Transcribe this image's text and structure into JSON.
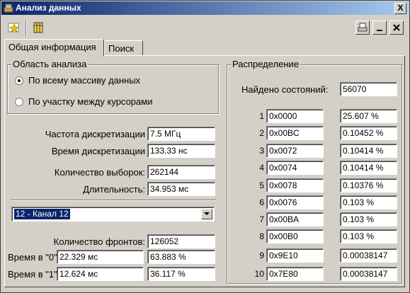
{
  "window": {
    "title": "Анализ данных",
    "close_label": "X"
  },
  "toolbar": {
    "icons": [
      "star-icon",
      "grid-icon"
    ],
    "window_icons": [
      "printer-icon",
      "minimize-icon",
      "close-icon"
    ]
  },
  "tabs": [
    {
      "label": "Общая информация",
      "active": true
    },
    {
      "label": "Поиск",
      "active": false
    }
  ],
  "analysis_area": {
    "label": "Область анализа",
    "options": [
      {
        "label": "По всему массиву данных",
        "selected": true
      },
      {
        "label": "По участку между курсорами",
        "selected": false
      }
    ]
  },
  "info": {
    "sampling_rate_label": "Частота дискретизации",
    "sampling_rate": "7.5 МГц",
    "sampling_time_label": "Время дискретизации",
    "sampling_time": "133.33 нс",
    "sample_count_label": "Количество выборок:",
    "sample_count": "262144",
    "duration_label": "Длительность:",
    "duration": "34.953 мс"
  },
  "channel": {
    "selected": "12 - Канал 12"
  },
  "edges": {
    "fronts_label": "Количество фронтов:",
    "fronts": "126052",
    "time0_label": "Время в \"0\":",
    "time0": "22.329 мс",
    "time0_pct": "63.883 %",
    "time1_label": "Время в \"1\":",
    "time1": "12.624 мс",
    "time1_pct": "36.117 %"
  },
  "distribution": {
    "label": "Распределение",
    "found_label": "Найдено состояний:",
    "found": "56070",
    "rows": [
      {
        "n": "1",
        "state": "0x0000",
        "pct": "25.607 %"
      },
      {
        "n": "2",
        "state": "0x00BC",
        "pct": "0.10452 %"
      },
      {
        "n": "3",
        "state": "0x0072",
        "pct": "0.10414 %"
      },
      {
        "n": "4",
        "state": "0x0074",
        "pct": "0.10414 %"
      },
      {
        "n": "5",
        "state": "0x0078",
        "pct": "0.10376 %"
      },
      {
        "n": "6",
        "state": "0x0076",
        "pct": "0.103 %"
      },
      {
        "n": "7",
        "state": "0x00BA",
        "pct": "0.103 %"
      },
      {
        "n": "8",
        "state": "0x00B0",
        "pct": "0.103 %"
      },
      {
        "n": "9",
        "state": "0x9E10",
        "pct": "0.00038147"
      },
      {
        "n": "10",
        "state": "0x7E80",
        "pct": "0.00038147"
      }
    ]
  },
  "colors": {
    "title_start": "#0a246a",
    "title_end": "#a6caf0",
    "face": "#d4d0c8",
    "selection": "#0a246a"
  }
}
